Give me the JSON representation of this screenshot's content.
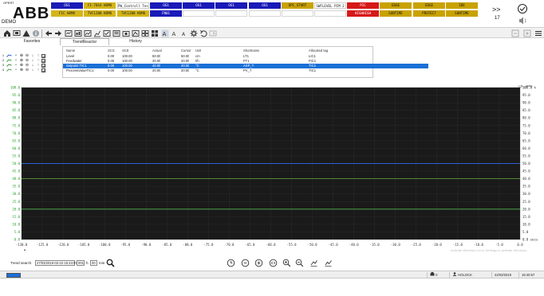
{
  "logo": {
    "brand": "ABB",
    "system": "DEMO",
    "sub": "OPERT"
  },
  "alarm_bar": {
    "row1": [
      {
        "text": "OS1",
        "color": "blue"
      },
      {
        "text": "FI-701A HOMO",
        "color": "yellow"
      },
      {
        "text": "PW_Controll TestCtrl",
        "color": "white"
      },
      {
        "text": "OS1",
        "color": "blue"
      },
      {
        "text": "OS1",
        "color": "blue"
      },
      {
        "text": "OS1",
        "color": "blue"
      },
      {
        "text": "OS1",
        "color": "blue"
      },
      {
        "text": "OPC_START",
        "color": "gold"
      },
      {
        "text": "SWFLEVEL PIM 2",
        "color": "white"
      },
      {
        "text": "PIC",
        "color": "red"
      },
      {
        "text": "EDGE",
        "color": "gold"
      },
      {
        "text": "EDGE",
        "color": "gold"
      },
      {
        "text": "IDE",
        "color": "gold"
      }
    ],
    "row2": [
      {
        "text": "FIC HOMO",
        "color": "yellow"
      },
      {
        "text": "TVC1200 HOMO",
        "color": "yellow"
      },
      {
        "text": "TVC1200 HOMO",
        "color": "yellow"
      },
      {
        "text": "FN01",
        "color": "blue"
      },
      {
        "text": "",
        "color": "empty"
      },
      {
        "text": "",
        "color": "empty"
      },
      {
        "text": "",
        "color": "empty"
      },
      {
        "text": "",
        "color": "empty"
      },
      {
        "text": "",
        "color": "empty"
      },
      {
        "text": "HIGHHIGH",
        "color": "red"
      },
      {
        "text": "SUNTIME",
        "color": "gold"
      },
      {
        "text": "PROTECT",
        "color": "gold"
      },
      {
        "text": "SUNTIME",
        "color": "gold"
      }
    ],
    "more_label": ">>",
    "count": "17"
  },
  "toolbar": {
    "icons": [
      "home-icon",
      "monitor-icon",
      "warning-icon",
      "info-icon",
      "back-icon",
      "forward-icon",
      "display-icon",
      "process-icon",
      "trend-icon",
      "graph-icon",
      "checklist-icon",
      "report-icon",
      "camera-icon",
      "chart-icon",
      "history-icon",
      "layout-icon",
      "font-increase-icon",
      "font-decrease-icon",
      "font-small-icon",
      "settings-icon",
      "undo-icon",
      "redo-icon"
    ]
  },
  "tabs": [
    {
      "label": "Favorites",
      "active": false
    },
    {
      "label": "TrendReactor",
      "active": true
    },
    {
      "label": "History",
      "active": false
    }
  ],
  "legend": {
    "headers": {
      "name": "Name",
      "scs": "SCS",
      "sce": "SCE",
      "actual": "Actual",
      "cursor": "Cursor",
      "unit": "Unit",
      "shortname": "Shortname",
      "tag": "Allocated tag"
    },
    "rows": [
      {
        "index": "1",
        "name": "Level",
        "scs": "0.00",
        "sce": "100.00",
        "actual": "50.00",
        "cursor": "50.00",
        "unit": "cm",
        "shortname": "LT1",
        "tag": "LIC1",
        "selected": false
      },
      {
        "index": "2",
        "name": "Feedwater",
        "scs": "0.00",
        "sce": "100.00",
        "actual": "20.00",
        "cursor": "20.00",
        "unit": "t/h",
        "shortname": "FT1",
        "tag": "FIC1",
        "selected": false
      },
      {
        "index": "3",
        "name": "Setpoint TIC1",
        "scs": "0.00",
        "sce": "100.00",
        "actual": "40.00",
        "cursor": "40.00",
        "unit": "°C",
        "shortname": "ASP_T",
        "tag": "TIC1",
        "selected": true
      },
      {
        "index": "4",
        "name": "ProcessValueTIC1",
        "scs": "0.00",
        "sce": "100.00",
        "actual": "20.00",
        "cursor": "20.00",
        "unit": "°C",
        "shortname": "PV_T",
        "tag": "TIC1",
        "selected": false
      }
    ]
  },
  "chart_data": {
    "type": "line",
    "y_ticks": [
      "100.0",
      "95.0",
      "90.0",
      "85.0",
      "80.0",
      "75.0",
      "70.0",
      "65.0",
      "60.0",
      "55.0",
      "50.0",
      "45.0",
      "40.0",
      "35.0",
      "30.0",
      "25.0",
      "20.0",
      "15.0",
      "10.0",
      "5.0",
      "0.0"
    ],
    "y_right_ticks": [
      "100.0 %",
      "95.0",
      "90.0",
      "85.0",
      "80.0",
      "75.0",
      "70.0",
      "65.0",
      "60.0",
      "55.0",
      "50.0",
      "45.0",
      "40.0",
      "35.0",
      "30.0",
      "25.0",
      "20.0",
      "15.0",
      "10.0",
      "5.0",
      "0.0 secs"
    ],
    "x_ticks": [
      "-130.0",
      "-125.0",
      "-120.0",
      "-105.0",
      "-100.0",
      "-95.0",
      "-90.0",
      "-85.0",
      "-80.0",
      "-75.0",
      "-70.0",
      "-65.0",
      "-60.0",
      "-55.0",
      "-50.0",
      "-45.0",
      "-40.0",
      "-35.0",
      "-30.0",
      "-25.0",
      "-20.0",
      "-15.0",
      "-10.0",
      "-5.0",
      "0.0"
    ],
    "ylim": [
      0,
      100
    ],
    "scale_label": "[0..100]",
    "series": [
      {
        "values": [
          50,
          50
        ],
        "color": "#2a5fd0"
      },
      {
        "values": [
          20,
          20
        ],
        "color": "#2aa02a"
      },
      {
        "values": [
          40,
          40
        ],
        "color": "#5a9a3a"
      },
      {
        "values": [
          20,
          20
        ],
        "color": "#4f9a4f"
      }
    ],
    "background": "#1a1a1a",
    "grid": true
  },
  "bottom": {
    "trend_search_label": "Trend search",
    "datetime_value": "27/03/2019-03-22-15:43:57",
    "hours_value": "001",
    "hours_unit": "h",
    "minutes_value": "00",
    "minutes_unit": "min",
    "zoom_icons": [
      "zoom-time-in-icon",
      "zoom-time-out-icon",
      "zoom-time-reset-icon",
      "zoom-time-fit-icon",
      "zoom-in-icon",
      "zoom-out-icon",
      "pan-left-icon",
      "pan-right-icon"
    ]
  },
  "status": {
    "printer_count": "0",
    "user": "HOLOCK",
    "date": "22/03/2019",
    "time": "15:40:57"
  },
  "watermark": "Activate Windows Go to Settings to activate Windows."
}
